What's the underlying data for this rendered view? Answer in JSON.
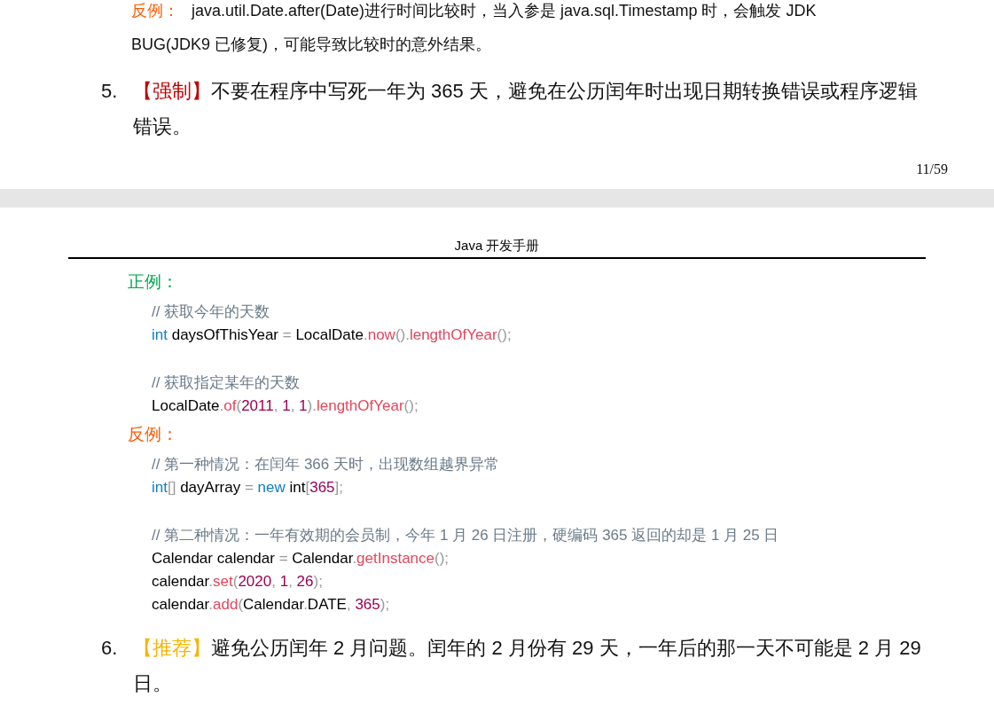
{
  "pages": [
    {
      "kind": "tail",
      "examples": [
        {
          "kind": "negative",
          "label": "反例：",
          "text": "java.util.Date.after(Date)进行时间比较时，当入参是 java.sql.Timestamp 时，会触发 JDK BUG(JDK9 已修复)，可能导致比较时的意外结果。"
        }
      ],
      "rule": {
        "number": "5.",
        "tag": "【强制】",
        "kind": "mandatory",
        "text": "不要在程序中写死一年为 365 天，避免在公历闰年时出现日期转换错误或程序逻辑错误。"
      },
      "page_number": "11/59"
    },
    {
      "kind": "head",
      "header": "Java 开发手册",
      "examples": [
        {
          "kind": "positive",
          "label": "正例：",
          "groups": [
            [
              [
                {
                  "kind": "comment",
                  "text": "// 获取今年的天数"
                }
              ],
              [
                {
                  "kind": "keyword",
                  "text": "int"
                },
                {
                  "kind": "plain",
                  "text": " daysOfThisYear "
                },
                {
                  "kind": "punct",
                  "text": "="
                },
                {
                  "kind": "plain",
                  "text": " LocalDate"
                },
                {
                  "kind": "punct",
                  "text": "."
                },
                {
                  "kind": "method",
                  "text": "now"
                },
                {
                  "kind": "punct",
                  "text": "()."
                },
                {
                  "kind": "method",
                  "text": "lengthOfYear"
                },
                {
                  "kind": "punct",
                  "text": "();"
                }
              ]
            ],
            [
              [
                {
                  "kind": "comment",
                  "text": "// 获取指定某年的天数"
                }
              ],
              [
                {
                  "kind": "plain",
                  "text": "LocalDate"
                },
                {
                  "kind": "punct",
                  "text": "."
                },
                {
                  "kind": "method",
                  "text": "of"
                },
                {
                  "kind": "punct",
                  "text": "("
                },
                {
                  "kind": "number",
                  "text": "2011"
                },
                {
                  "kind": "punct",
                  "text": ", "
                },
                {
                  "kind": "number",
                  "text": "1"
                },
                {
                  "kind": "punct",
                  "text": ", "
                },
                {
                  "kind": "number",
                  "text": "1"
                },
                {
                  "kind": "punct",
                  "text": ")."
                },
                {
                  "kind": "method",
                  "text": "lengthOfYear"
                },
                {
                  "kind": "punct",
                  "text": "();"
                }
              ]
            ]
          ]
        },
        {
          "kind": "negative",
          "label": "反例：",
          "groups": [
            [
              [
                {
                  "kind": "comment",
                  "text": "// 第一种情况：在闰年 366 天时，出现数组越界异常"
                }
              ],
              [
                {
                  "kind": "keyword",
                  "text": "int"
                },
                {
                  "kind": "punct",
                  "text": "[]"
                },
                {
                  "kind": "plain",
                  "text": " dayArray "
                },
                {
                  "kind": "punct",
                  "text": "= "
                },
                {
                  "kind": "keyword",
                  "text": "new"
                },
                {
                  "kind": "plain",
                  "text": " int"
                },
                {
                  "kind": "punct",
                  "text": "["
                },
                {
                  "kind": "number",
                  "text": "365"
                },
                {
                  "kind": "punct",
                  "text": "];"
                }
              ]
            ],
            [
              [
                {
                  "kind": "comment",
                  "text": "// 第二种情况：一年有效期的会员制，今年 1 月 26 日注册，硬编码 365 返回的却是 1 月 25 日"
                }
              ],
              [
                {
                  "kind": "plain",
                  "text": "Calendar calendar "
                },
                {
                  "kind": "punct",
                  "text": "="
                },
                {
                  "kind": "plain",
                  "text": " Calendar"
                },
                {
                  "kind": "punct",
                  "text": "."
                },
                {
                  "kind": "method",
                  "text": "getInstance"
                },
                {
                  "kind": "punct",
                  "text": "();"
                }
              ],
              [
                {
                  "kind": "plain",
                  "text": "calendar"
                },
                {
                  "kind": "punct",
                  "text": "."
                },
                {
                  "kind": "method",
                  "text": "set"
                },
                {
                  "kind": "punct",
                  "text": "("
                },
                {
                  "kind": "number",
                  "text": "2020"
                },
                {
                  "kind": "punct",
                  "text": ", "
                },
                {
                  "kind": "number",
                  "text": "1"
                },
                {
                  "kind": "punct",
                  "text": ", "
                },
                {
                  "kind": "number",
                  "text": "26"
                },
                {
                  "kind": "punct",
                  "text": ");"
                }
              ],
              [
                {
                  "kind": "plain",
                  "text": "calendar"
                },
                {
                  "kind": "punct",
                  "text": "."
                },
                {
                  "kind": "method",
                  "text": "add"
                },
                {
                  "kind": "punct",
                  "text": "("
                },
                {
                  "kind": "plain",
                  "text": "Calendar"
                },
                {
                  "kind": "punct",
                  "text": "."
                },
                {
                  "kind": "plain",
                  "text": "DATE"
                },
                {
                  "kind": "punct",
                  "text": ", "
                },
                {
                  "kind": "number",
                  "text": "365"
                },
                {
                  "kind": "punct",
                  "text": ");"
                }
              ]
            ]
          ]
        }
      ],
      "rule": {
        "number": "6.",
        "tag": "【推荐】",
        "kind": "recommended",
        "text": "避免公历闰年 2 月问题。闰年的 2 月份有 29 天，一年后的那一天不可能是 2 月 29 日。"
      }
    }
  ]
}
